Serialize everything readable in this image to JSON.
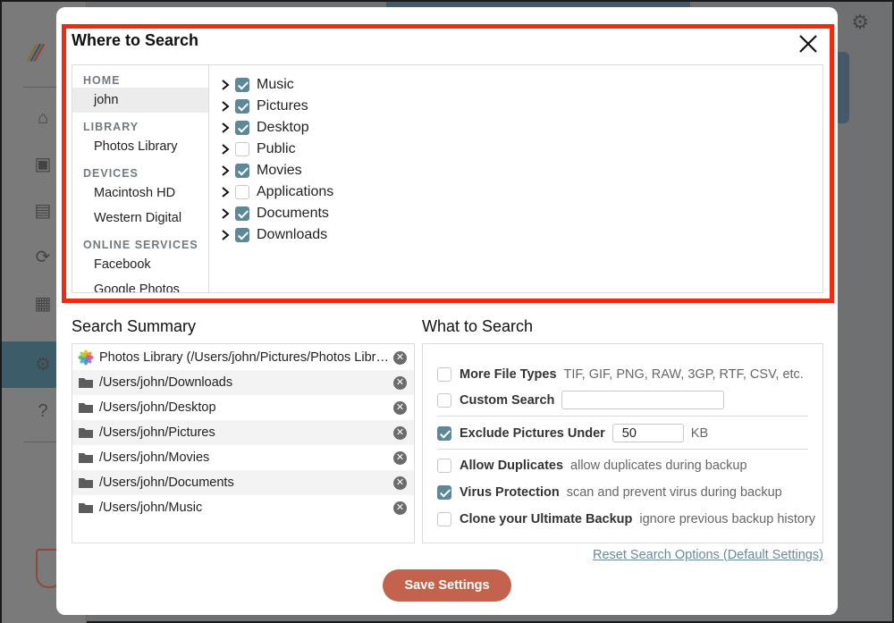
{
  "modal": {
    "title": "Where to Search",
    "close_icon": "close-icon"
  },
  "locations": {
    "sections": [
      {
        "heading": "HOME",
        "items": [
          "john"
        ]
      },
      {
        "heading": "LIBRARY",
        "items": [
          "Photos Library"
        ]
      },
      {
        "heading": "DEVICES",
        "items": [
          "Macintosh HD",
          "Western Digital"
        ]
      },
      {
        "heading": "ONLINE SERVICES",
        "items": [
          "Facebook",
          "Google Photos"
        ]
      }
    ],
    "selected": "john"
  },
  "folders": [
    {
      "name": "Music",
      "checked": true
    },
    {
      "name": "Pictures",
      "checked": true
    },
    {
      "name": "Desktop",
      "checked": true
    },
    {
      "name": "Public",
      "checked": false
    },
    {
      "name": "Movies",
      "checked": true
    },
    {
      "name": "Applications",
      "checked": false
    },
    {
      "name": "Documents",
      "checked": true
    },
    {
      "name": "Downloads",
      "checked": true
    }
  ],
  "summary": {
    "title": "Search Summary",
    "items": [
      {
        "icon": "photos-app-icon",
        "path": "Photos Library (/Users/john/Pictures/Photos Library.photoslibrary)"
      },
      {
        "icon": "folder-icon",
        "path": "/Users/john/Downloads"
      },
      {
        "icon": "folder-icon",
        "path": "/Users/john/Desktop"
      },
      {
        "icon": "folder-icon",
        "path": "/Users/john/Pictures"
      },
      {
        "icon": "folder-icon",
        "path": "/Users/john/Movies"
      },
      {
        "icon": "folder-icon",
        "path": "/Users/john/Documents"
      },
      {
        "icon": "folder-icon",
        "path": "/Users/john/Music"
      }
    ]
  },
  "what": {
    "title": "What to Search",
    "more_types": {
      "label": "More File Types",
      "desc": "TIF, GIF, PNG, RAW, 3GP, RTF, CSV, etc.",
      "checked": false
    },
    "custom": {
      "label": "Custom Search",
      "value": "",
      "checked": false
    },
    "exclude": {
      "label": "Exclude Pictures Under",
      "value": "50",
      "unit": "KB",
      "checked": true
    },
    "duplicates": {
      "label": "Allow Duplicates",
      "desc": "allow duplicates during backup",
      "checked": false
    },
    "virus": {
      "label": "Virus Protection",
      "desc": "scan and prevent virus during backup",
      "checked": true
    },
    "clone": {
      "label": "Clone your Ultimate Backup",
      "desc": "ignore previous backup history",
      "checked": false
    }
  },
  "reset_link": "Reset Search Options (Default Settings)",
  "save_button": "Save Settings",
  "colors": {
    "accent": "#5e8797",
    "save": "#c4634d",
    "highlight_frame": "#ef2a0e"
  }
}
